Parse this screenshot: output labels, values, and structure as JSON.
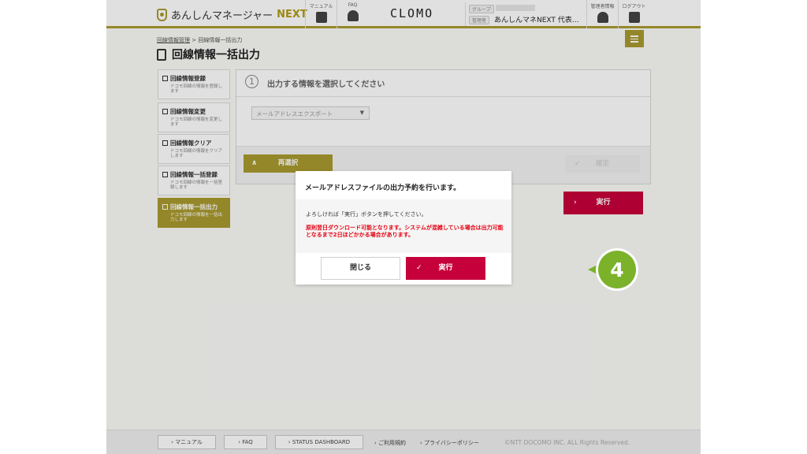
{
  "header": {
    "logo_text": "あんしんマネージャー",
    "logo_next": "NEXT",
    "manual_caption": "マニュアル",
    "faq_caption": "FAQ",
    "brand_text": "CLOMO",
    "group_label": "グループ",
    "admin_label": "管理者",
    "admin_name": "あんしんマネNEXT 代表…",
    "admin_info_caption": "管理者情報",
    "logout_caption": "ログアウト"
  },
  "breadcrumb": {
    "parent": "回線情報管理",
    "separator": ">",
    "current": "回線情報一括出力"
  },
  "page_title": "回線情報一括出力",
  "sidebar": {
    "items": [
      {
        "title": "回線情報登録",
        "desc": "ドコモ回線の情報を登録します"
      },
      {
        "title": "回線情報変更",
        "desc": "ドコモ回線の情報を変更します"
      },
      {
        "title": "回線情報クリア",
        "desc": "ドコモ回線の情報をクリアします"
      },
      {
        "title": "回線情報一括登録",
        "desc": "ドコモ回線の情報を一括登録します"
      },
      {
        "title": "回線情報一括出力",
        "desc": "ドコモ回線の情報を一括出力します"
      }
    ]
  },
  "panel": {
    "step_number": "1",
    "step_title": "出力する情報を選択してください",
    "select_value": "メールアドレスエクスポート",
    "reselect_label": "再選択",
    "confirm_label": "確定",
    "execute_label": "実行"
  },
  "modal": {
    "title": "メールアドレスファイルの出力予約を行います。",
    "text": "よろしければ「実行」ボタンを押してください。",
    "warning": "原則翌日ダウンロード可能となります。システムが混雑している場合は出力可能となるまで2日ほどかかる場合があります。",
    "close_label": "閉じる",
    "execute_label": "実行"
  },
  "step_marker": "4",
  "footer": {
    "manual": "マニュアル",
    "faq": "FAQ",
    "status": "STATUS DASHBOARD",
    "terms": "ご利用規約",
    "privacy": "プライバシーポリシー",
    "copyright": "©NTT DOCOMO INC. ALL Rights Reserved."
  },
  "colors": {
    "accent": "#a99a2f",
    "execute": "#c6003a",
    "warning": "#e60012",
    "marker": "#7bb22a"
  }
}
